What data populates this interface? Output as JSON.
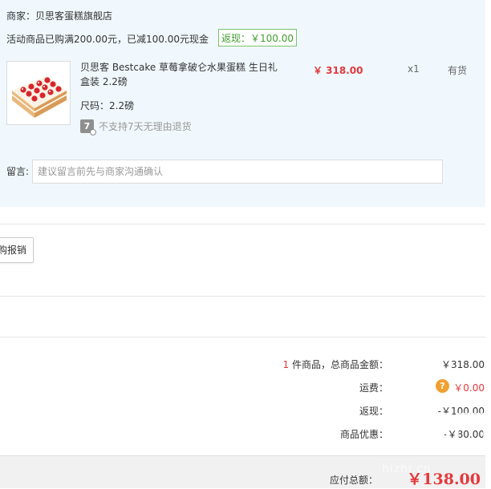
{
  "order": {
    "seller": "商家：贝思客蛋糕旗舰店",
    "promo": "活动商品已购满200.00元，已减100.00元现金",
    "rebate_tag": "返现：￥100.00",
    "product": {
      "name": "贝思客 Bestcake 草莓拿破仑水果蛋糕 生日礼盒装 2.2磅",
      "price": "￥ 318.00",
      "qty": "x1",
      "stock": "有货",
      "size": "尺码：2.2磅",
      "return_icon_char": "7",
      "return_policy": "不支持7天无理由退货"
    },
    "note_label": "留言:",
    "note_placeholder": "建议留言前先与商家沟通确认"
  },
  "reimbursement_button": "购报销",
  "summary": {
    "count": "1",
    "count_suffix": " 件商品，总商品金额：",
    "goods_total": "￥318.00",
    "shipping_label": "运费：",
    "shipping_value": "￥0.00",
    "shipping_help_icon": "?",
    "rebate_label": "返现：",
    "rebate_value": "-￥100.00",
    "discount_label": "商品优惠：",
    "discount_value": "-￥80.00",
    "total_label": "应付总额：",
    "total_value": "￥138.00"
  },
  "watermark": {
    "text": "hizhi.cn"
  },
  "colors": {
    "order_bg": "#f0f8fd",
    "price_red": "#e4393c",
    "rebate_green": "#3e9d2e",
    "help_orange": "#f0a030"
  },
  "icons": {
    "return_policy": "no-7-day-return-icon",
    "shipping_help": "question-circle-icon"
  }
}
